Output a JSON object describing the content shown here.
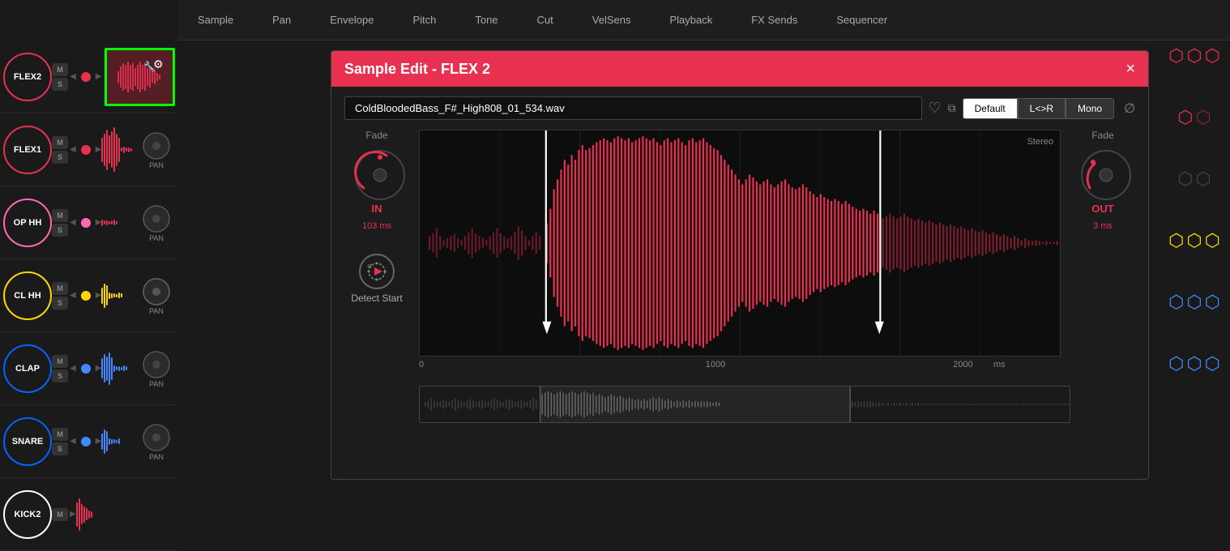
{
  "app": {
    "title": "Sample Edit - FLEX 2"
  },
  "topNav": {
    "items": [
      "Sample",
      "Pan",
      "Envelope",
      "Pitch",
      "Tone",
      "Cut",
      "VelSens",
      "Playback",
      "FX Sends",
      "Sequencer"
    ]
  },
  "tracks": [
    {
      "id": "flex2",
      "name": "FLEX2",
      "color": "#e83050",
      "dotColor": "#e83050",
      "waveColor": "#e83050",
      "barCount": 20,
      "hasSampleBtn": true
    },
    {
      "id": "flex1",
      "name": "FLEX1",
      "color": "#e83050",
      "dotColor": "#e83050",
      "waveColor": "#e83050",
      "barCount": 18
    },
    {
      "id": "openhh",
      "name": "OP HH",
      "color": "#ff69b4",
      "dotColor": "#ff69b4",
      "waveColor": "#e83050",
      "barCount": 8
    },
    {
      "id": "clhh",
      "name": "CL HH",
      "color": "#ffd700",
      "dotColor": "#ffd700",
      "waveColor": "#ffd700",
      "barCount": 16
    },
    {
      "id": "clap",
      "name": "CLAP",
      "color": "#3366ff",
      "dotColor": "#4488ff",
      "waveColor": "#4488ff",
      "barCount": 16
    },
    {
      "id": "snare",
      "name": "SNARE",
      "color": "#4488ff",
      "dotColor": "#4488ff",
      "waveColor": "#4488ff",
      "barCount": 16
    },
    {
      "id": "kick2",
      "name": "KICK2",
      "color": "#888888",
      "dotColor": "#888888",
      "waveColor": "#e83050",
      "barCount": 12
    }
  ],
  "sampleEdit": {
    "title": "Sample Edit - FLEX 2",
    "closeLabel": "×",
    "fileName": "ColdBloodedBass_F#_High808_01_534.wav",
    "modes": {
      "default": "Default",
      "lr": "L<>R",
      "mono": "Mono"
    },
    "activeMode": "Default",
    "stereoLabel": "Stereo",
    "fadeIn": {
      "label": "Fade",
      "sublabel": "IN",
      "value": "103 ms"
    },
    "fadeOut": {
      "label": "Fade",
      "sublabel": "OUT",
      "value": "3 ms"
    },
    "detectStart": {
      "label": "Detect Start"
    },
    "timeline": {
      "zero": "0",
      "mid": "1000",
      "end": "2000",
      "unit": "ms"
    },
    "markerStart": "28",
    "markerEnd": "67"
  },
  "rightPanel": {
    "hexGroups": [
      {
        "color": "#e83050",
        "items": [
          "⬡",
          "⬡",
          "⬡"
        ]
      },
      {
        "color": "#ff69b4",
        "items": [
          "⬡",
          "⬡"
        ]
      },
      {
        "color": "#ffd700",
        "items": [
          "⬡",
          "⬡",
          "⬡"
        ]
      },
      {
        "color": "#4488ff",
        "items": [
          "⬡",
          "⬡",
          "⬡"
        ]
      },
      {
        "color": "#4488ff",
        "items": [
          "⬡",
          "⬡",
          "⬡"
        ]
      }
    ]
  }
}
